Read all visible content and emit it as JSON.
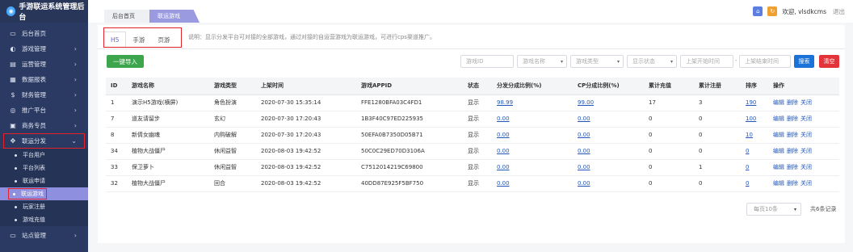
{
  "app": {
    "title": "手游联运系统管理后台"
  },
  "sidebar": {
    "items": [
      {
        "label": "后台首页",
        "icon": "monitor-icon",
        "arrow": false
      },
      {
        "label": "游戏管理",
        "icon": "gamepad-icon",
        "arrow": true
      },
      {
        "label": "运营管理",
        "icon": "document-icon",
        "arrow": true
      },
      {
        "label": "数据报表",
        "icon": "database-icon",
        "arrow": true
      },
      {
        "label": "财务管理",
        "icon": "money-icon",
        "arrow": true
      },
      {
        "label": "推广平台",
        "icon": "eye-icon",
        "arrow": true
      },
      {
        "label": "商务专员",
        "icon": "briefcase-icon",
        "arrow": true
      },
      {
        "label": "联运分发",
        "icon": "move-icon",
        "arrow": "down"
      }
    ],
    "sub": [
      "平台用户",
      "平台列表",
      "联运申请",
      "联运游戏",
      "玩家注册",
      "游戏充值"
    ],
    "last": {
      "label": "站点管理",
      "icon": "monitor-icon"
    }
  },
  "breadcrumb": {
    "home": "后台首页",
    "current": "联运游戏"
  },
  "header": {
    "welcome": "欢迎, vlsdkcms",
    "logout": "退出"
  },
  "tabs": [
    "H5",
    "手游",
    "页游"
  ],
  "tip": "说明：显示分发平台可对接的全部游戏，通过对接的自运营游戏为联运游戏，可进行cps渠道推广。",
  "toolbar": {
    "import": "一键导入",
    "search": "搜索",
    "clear": "清空"
  },
  "filters": {
    "game_id": "游戏ID",
    "game_name": "游戏名称",
    "game_type": "游戏类型",
    "status": "显示状态",
    "start": "上架开始时间",
    "end": "上架结束时间",
    "dash": "-"
  },
  "table": {
    "headers": [
      "ID",
      "游戏名称",
      "游戏类型",
      "上架时间",
      "游戏APPID",
      "状态",
      "分发分成比例(%)",
      "CP分成比例(%)",
      "累计充值",
      "累计注册",
      "排序",
      "操作"
    ],
    "rows": [
      [
        "1",
        "演示H5游戏(横屏)",
        "角色扮演",
        "2020-07-30 15:35:14",
        "FFE1280BFA03C4FD1",
        "显示",
        "98.99",
        "99.00",
        "17",
        "3",
        "190"
      ],
      [
        "7",
        "道友请留步",
        "玄幻",
        "2020-07-30 17:20:43",
        "1B3F40C97ED225935",
        "显示",
        "0.00",
        "0.00",
        "0",
        "0",
        "100"
      ],
      [
        "8",
        "新倩女幽魂",
        "内购破解",
        "2020-07-30 17:20:43",
        "50EFA0B7350D05B71",
        "显示",
        "0.00",
        "0.00",
        "0",
        "0",
        "10"
      ],
      [
        "34",
        "植物大战僵尸",
        "休闲益智",
        "2020-08-03 19:42:52",
        "50C0C29ED70D3106A",
        "显示",
        "0.00",
        "0.00",
        "0",
        "0",
        "0"
      ],
      [
        "33",
        "保卫萝卜",
        "休闲益智",
        "2020-08-03 19:42:52",
        "C7512014219C69800",
        "显示",
        "0.00",
        "0.00",
        "0",
        "1",
        "0"
      ],
      [
        "32",
        "植物大战僵尸",
        "回合",
        "2020-08-03 19:42:52",
        "40DD87E925F5BF750",
        "显示",
        "0.00",
        "0.00",
        "0",
        "0",
        "0"
      ]
    ],
    "ops": [
      "编辑",
      "删除",
      "关闭"
    ]
  },
  "pager": {
    "per_page": "每页10条",
    "total": "共6条记录"
  }
}
